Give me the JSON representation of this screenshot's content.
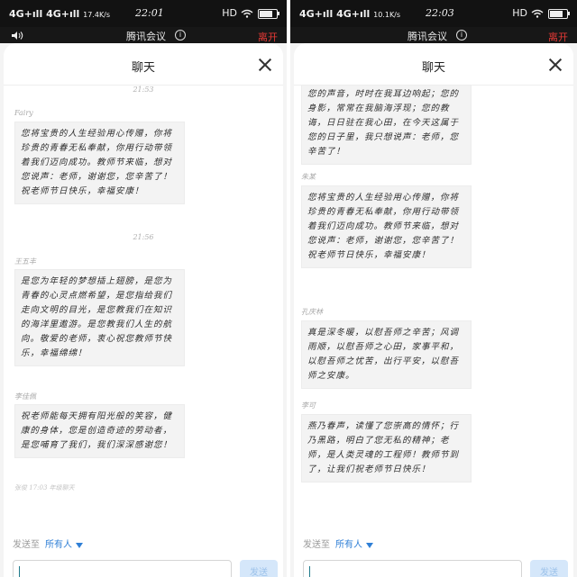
{
  "left": {
    "status": {
      "signal1": "4G+ıll",
      "signal2": "4G+ıll",
      "speed": "17.4K/s",
      "time": "22:01",
      "right": "HD",
      "battery_level": 0.8
    },
    "meeting_title": "腾讯会议",
    "info_label": "i",
    "leave_label": "离开",
    "chat_title": "聊天",
    "messages": [
      {
        "kind": "time",
        "text": "21:53"
      },
      {
        "kind": "sender",
        "text": "Fairy"
      },
      {
        "kind": "bubble",
        "text": "您将宝贵的人生经验用心传赠，你将珍贵的青春无私奉献，你用行动带领着我们迈向成功。教师节来临，想对您说声：老师，谢谢您，您辛苦了！祝老师节日快乐，幸福安康！"
      },
      {
        "kind": "time",
        "text": "21:56"
      },
      {
        "kind": "sender",
        "text": "王五丰"
      },
      {
        "kind": "bubble",
        "text": "是您为年轻的梦想插上翅膀，是您为青春的心灵点燃希望，是您指给我们走向文明的目光，是您教我们在知识的海洋里遨游。是您教我们人生的航向。敬爱的老师，衷心祝您教师节快乐，幸福绵绵！"
      },
      {
        "kind": "sender",
        "text": "李佳佩"
      },
      {
        "kind": "bubble",
        "text": "祝老师能每天拥有阳光般的笑容，健康的身体，您是创造奇迹的劳动者，是您哺育了我们，我们深深感谢您！"
      },
      {
        "kind": "faded",
        "text": "张俊 17:03 年级聊天"
      }
    ],
    "send_to_label": "发送至",
    "send_to_target": "所有人",
    "input_placeholder": "",
    "send_label": "发送"
  },
  "right": {
    "status": {
      "signal1": "4G+ıll",
      "signal2": "4G+ıll",
      "speed": "10.1K/s",
      "time": "22:03",
      "right": "HD",
      "battery_level": 0.8
    },
    "meeting_title": "腾讯会议",
    "info_label": "i",
    "leave_label": "离开",
    "chat_title": "聊天",
    "messages": [
      {
        "kind": "bubble",
        "text": "您的声音，时时在我耳边响起；您的身影，常常在我脑海浮现；您的教诲，日日驻在我心田，在今天这属于您的日子里，我只想说声：老师，您辛苦了！"
      },
      {
        "kind": "sender",
        "text": "朱某"
      },
      {
        "kind": "bubble",
        "text": "您将宝贵的人生经验用心传赠，你将珍贵的青春无私奉献，你用行动带领着我们迈向成功。教师节来临，想对您说声：老师，谢谢您，您辛苦了！祝老师节日快乐，幸福安康！"
      },
      {
        "kind": "sender",
        "text": "孔庆林"
      },
      {
        "kind": "bubble",
        "text": "真是深冬暖，以慰吾师之辛苦；风调雨顺，以慰吾师之心田，家事平和，以慰吾师之忧苦，出行平安，以慰吾师之安康。"
      },
      {
        "kind": "sender",
        "text": "李可"
      },
      {
        "kind": "bubble",
        "text": "燕乃春声，读懂了您崇高的情怀；行乃黑路，明白了您无私的精神；老师，是人类灵魂的工程师！教师节到了，让我们祝老师节日快乐！"
      }
    ],
    "send_to_label": "发送至",
    "send_to_target": "所有人",
    "input_placeholder": "",
    "send_label": "发送"
  }
}
